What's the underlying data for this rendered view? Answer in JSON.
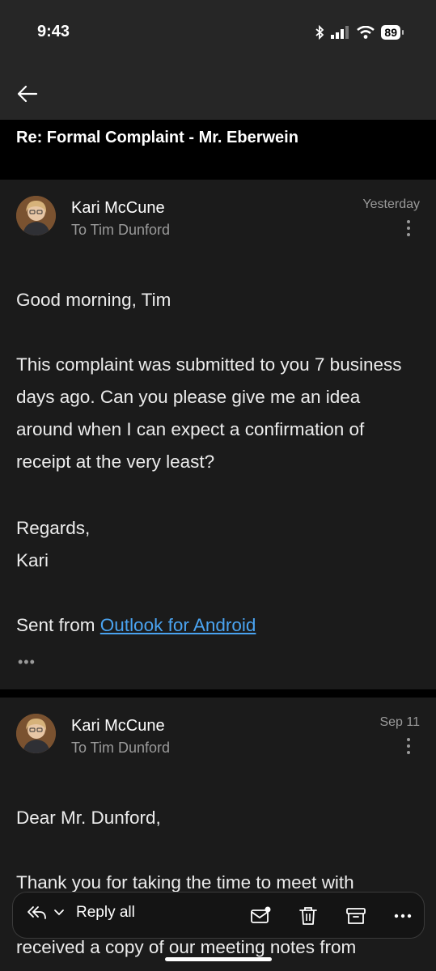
{
  "status_bar": {
    "time": "9:43",
    "battery": "89"
  },
  "subject": "Re: Formal Complaint - Mr. Eberwein",
  "messages": [
    {
      "sender": "Kari McCune",
      "recipient": "To Tim Dunford",
      "date": "Yesterday",
      "greeting": "Good morning, Tim",
      "paragraph": "This complaint was submitted to you 7 business days ago. Can you please give me an idea around when I can expect a confirmation of receipt at the very least?",
      "regards": "Regards,",
      "signoff": "Kari",
      "sent_from": "Sent from ",
      "sent_link": "Outlook for Android",
      "trim": "•••"
    },
    {
      "sender": "Kari McCune",
      "recipient": "To Tim Dunford",
      "date": "Sep 11",
      "greeting": "Dear Mr. Dunford,",
      "paragraph_visible": "Thank you for taking the time to meet with",
      "paragraph_partial": "received a copy of our meeting notes from"
    }
  ],
  "toolbar": {
    "reply_label": "Reply all"
  },
  "icons": {
    "back": "back-arrow-icon",
    "more": "more-vertical-icon",
    "reply_all": "reply-all-icon",
    "mark_unread": "mark-unread-icon",
    "delete": "trash-icon",
    "archive": "archive-icon",
    "overflow": "more-horizontal-icon"
  },
  "colors": {
    "link": "#4aa3f0",
    "background": "#1b1b1b",
    "toolbar": "#141414"
  }
}
